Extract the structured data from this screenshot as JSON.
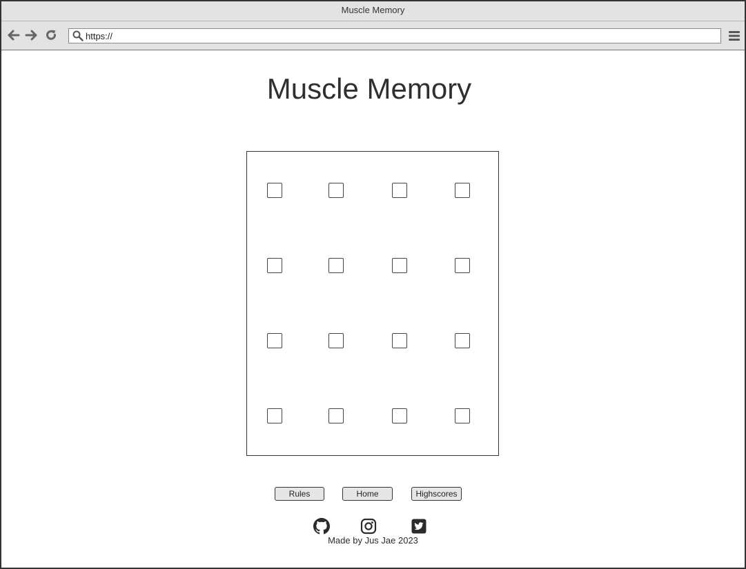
{
  "browser": {
    "window_title": "Muscle Memory",
    "url": "https://",
    "icons": {
      "back": "arrow-left-icon",
      "forward": "arrow-right-icon",
      "reload": "reload-icon",
      "search": "search-icon",
      "menu": "hamburger-menu-icon"
    }
  },
  "page": {
    "title": "Muscle Memory",
    "board": {
      "rows": 4,
      "columns": 4,
      "cell_state": "empty"
    },
    "buttons": {
      "rules": "Rules",
      "home": "Home",
      "highscores": "Highscores"
    },
    "social_icons": [
      "github-icon",
      "instagram-icon",
      "twitter-icon"
    ],
    "footer": "Made by Jus Jae 2023"
  },
  "colors": {
    "chrome": "#e3e3e3",
    "border": "#333333",
    "text": "#2b2b2b",
    "button_bg": "#e6e6e6"
  }
}
